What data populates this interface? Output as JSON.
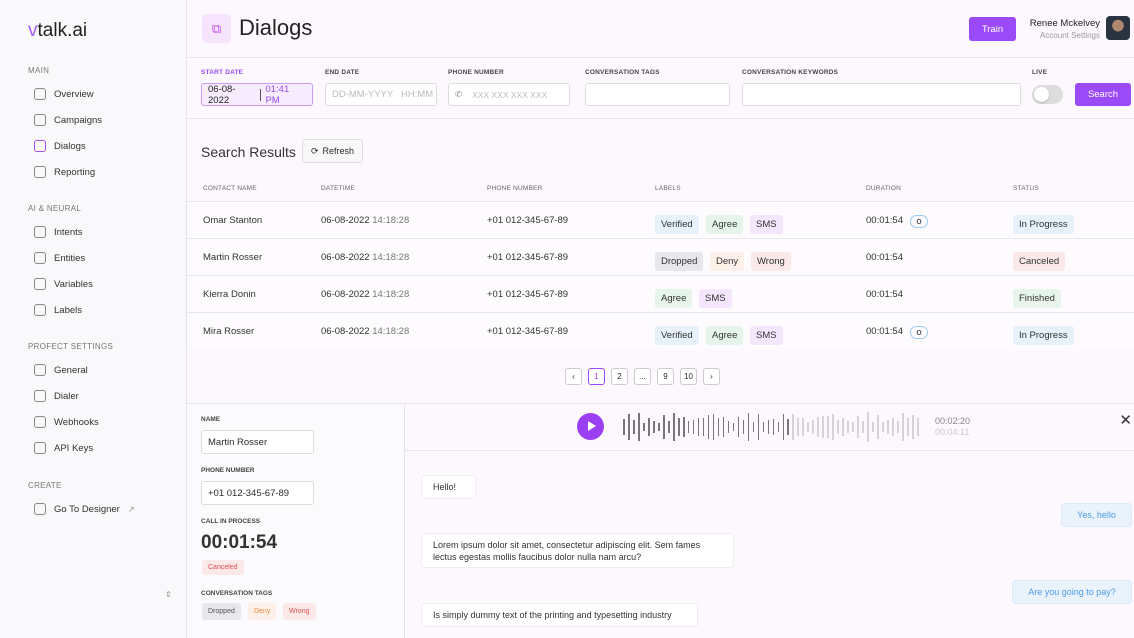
{
  "app": {
    "logo": "talk.ai",
    "logo_mark": "v"
  },
  "sidebar": {
    "sections": [
      {
        "title": "MAIN",
        "items": [
          {
            "label": "Overview",
            "icon": "pie-chart-icon"
          },
          {
            "label": "Campaigns",
            "icon": "megaphone-icon"
          },
          {
            "label": "Dialogs",
            "icon": "chat-icon",
            "active": true
          },
          {
            "label": "Reporting",
            "icon": "presentation-icon"
          }
        ]
      },
      {
        "title": "AI & NEURAL",
        "items": [
          {
            "label": "Intents",
            "icon": "chat-bubble-icon"
          },
          {
            "label": "Entities",
            "icon": "entities-icon"
          },
          {
            "label": "Variables",
            "icon": "grid-icon"
          },
          {
            "label": "Labels",
            "icon": "voicemail-icon"
          }
        ]
      },
      {
        "title": "PROFECT SETTINGS",
        "items": [
          {
            "label": "General",
            "icon": "bar-chart-icon"
          },
          {
            "label": "Dialer",
            "icon": "phone-icon"
          },
          {
            "label": "Webhooks",
            "icon": "webhook-icon"
          },
          {
            "label": "API Keys",
            "icon": "hexagon-icon"
          }
        ]
      },
      {
        "title": "CREATE",
        "items": [
          {
            "label": "Go To Designer",
            "icon": "flow-icon",
            "external": "↗"
          }
        ]
      }
    ],
    "collapse_icon": "⌃⌄"
  },
  "header": {
    "title": "Dialogs",
    "train": "Train",
    "user_name": "Renee Mckelvey",
    "user_sub": "Account Settings"
  },
  "filters": {
    "start_label": "START DATE",
    "start_date": "06-08-2022",
    "start_time": "01:41 PM",
    "end_label": "END DATE",
    "end_placeholder": "DD-MM-YYYY   HH:MM",
    "phone_label": "PHONE NUMBER",
    "phone_placeholder": "XXX XXX XXX XXX",
    "tags_label": "CONVERSATION TAGS",
    "keywords_label": "CONVERSATION KEYWORDS",
    "live_label": "LIVE",
    "live_on": false,
    "search": "Search"
  },
  "results": {
    "title": "Search Results",
    "refresh": "Refresh",
    "columns": [
      "CONTACT NAME",
      "DATETIME",
      "PHONE NUMBER",
      "LABELS",
      "DURATION",
      "STATUS"
    ],
    "rows": [
      {
        "name": "Omar Stanton",
        "date": "06-08-2022",
        "time": "14:18:28",
        "phone": "+01 012-345-67-89",
        "labels": [
          [
            "Verified",
            "blue"
          ],
          [
            "Agree",
            "green"
          ],
          [
            "SMS",
            "purple"
          ]
        ],
        "duration": "00:01:54",
        "live": true,
        "status": [
          "In Progress",
          "blue"
        ]
      },
      {
        "name": "Martin Rosser",
        "date": "06-08-2022",
        "time": "14:18:28",
        "phone": "+01 012-345-67-89",
        "labels": [
          [
            "Dropped",
            "gray"
          ],
          [
            "Deny",
            "orange"
          ],
          [
            "Wrong",
            "red"
          ]
        ],
        "duration": "00:01:54",
        "live": false,
        "status": [
          "Canceled",
          "red"
        ]
      },
      {
        "name": "Kierra Donin",
        "date": "06-08-2022",
        "time": "14:18:28",
        "phone": "+01 012-345-67-89",
        "labels": [
          [
            "Agree",
            "green"
          ],
          [
            "SMS",
            "purple"
          ]
        ],
        "duration": "00:01:54",
        "live": false,
        "status": [
          "Finished",
          "green"
        ]
      },
      {
        "name": "Mira Rosser",
        "date": "06-08-2022",
        "time": "14:18:28",
        "phone": "+01 012-345-67-89",
        "labels": [
          [
            "Verified",
            "blue"
          ],
          [
            "Agree",
            "green"
          ],
          [
            "SMS",
            "purple"
          ]
        ],
        "duration": "00:01:54",
        "live": true,
        "status": [
          "In Progress",
          "blue"
        ]
      }
    ],
    "pages": [
      "1",
      "2",
      "...",
      "9",
      "10"
    ],
    "current_page": "1"
  },
  "detail": {
    "name_label": "NAME",
    "name": "Martin Rosser",
    "phone_label": "PHONE NUMBER",
    "phone": "+01 012-345-67-89",
    "call_label": "CALL IN PROCESS",
    "call_time": "00:01:54",
    "status": "Canceled",
    "tags_label": "CONVERSATION TAGS",
    "tags": [
      [
        "Dropped",
        "gray"
      ],
      [
        "Deny",
        "orange"
      ],
      [
        "Wrong",
        "red"
      ]
    ]
  },
  "audio": {
    "current": "00:02:20",
    "total": "00:04:11",
    "progress": 0.56
  },
  "messages": [
    {
      "text": "Hello!",
      "from": "bot"
    },
    {
      "text": "Yes, hello",
      "from": "user"
    },
    {
      "text": "Lorem ipsum dolor sit amet, consectetur adipiscing elit. Sem fames lectus egestas mollis faucibus dolor nulla nam arcu?",
      "from": "bot"
    },
    {
      "text": "Are you going to pay?",
      "from": "user"
    },
    {
      "text": "Is simply dummy text of the printing and typesetting industry",
      "from": "bot"
    }
  ]
}
